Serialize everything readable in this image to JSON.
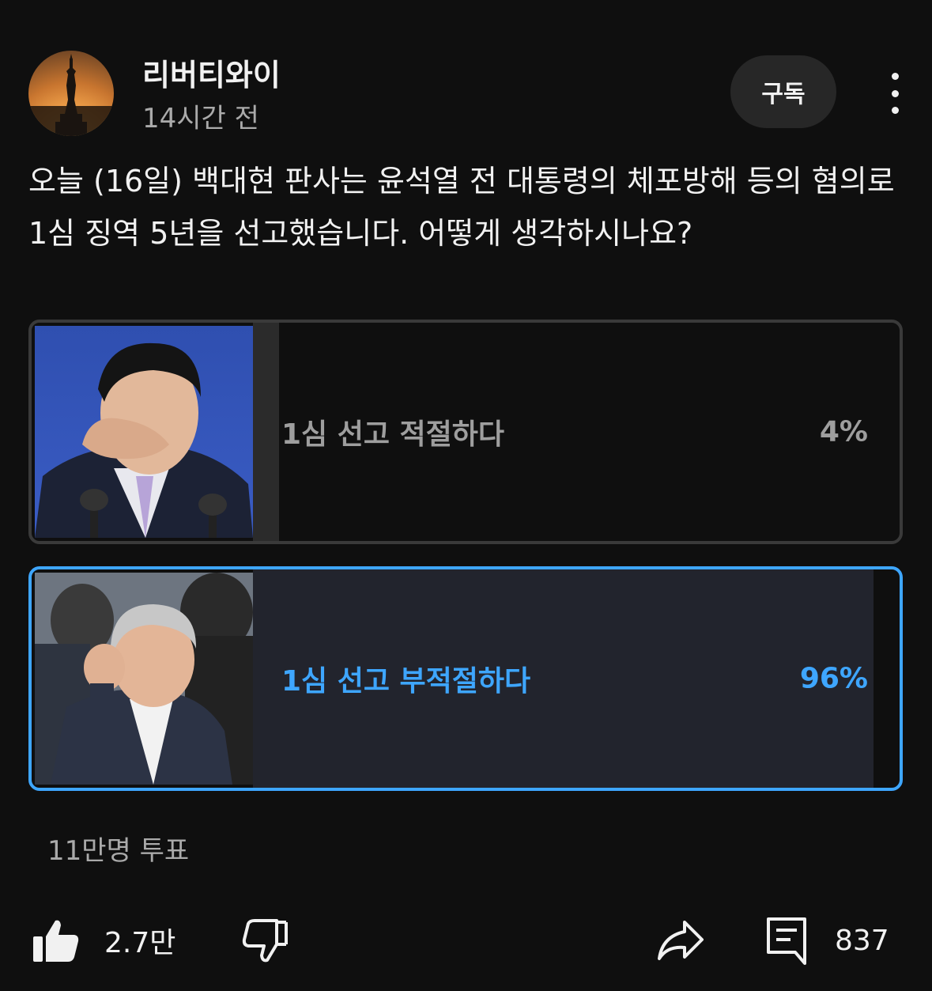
{
  "post": {
    "channel_name": "리버티와이",
    "time_ago": "14시간 전",
    "subscribe_label": "구독",
    "question": "오늘 (16일) 백대현 판사는 윤석열 전 대통령의 체포방해 등의 혐의로 1심 징역 5년을 선고했습니다. 어떻게 생각하시나요?"
  },
  "poll": {
    "options": [
      {
        "label": "1심 선고 적절하다",
        "percent_text": "4%",
        "percent": 4,
        "selected": false
      },
      {
        "label": "1심 선고 부적절하다",
        "percent_text": "96%",
        "percent": 96,
        "selected": true
      }
    ],
    "votes_label": "11만명 투표"
  },
  "actions": {
    "like_count": "2.7만",
    "comment_count": "837",
    "icons": [
      "thumbs-up-icon",
      "thumbs-down-icon",
      "share-icon",
      "comment-icon",
      "more-vertical-icon"
    ]
  },
  "colors": {
    "background": "#0f0f0f",
    "accent": "#3ea6ff",
    "muted_text": "#aaaaaa"
  }
}
